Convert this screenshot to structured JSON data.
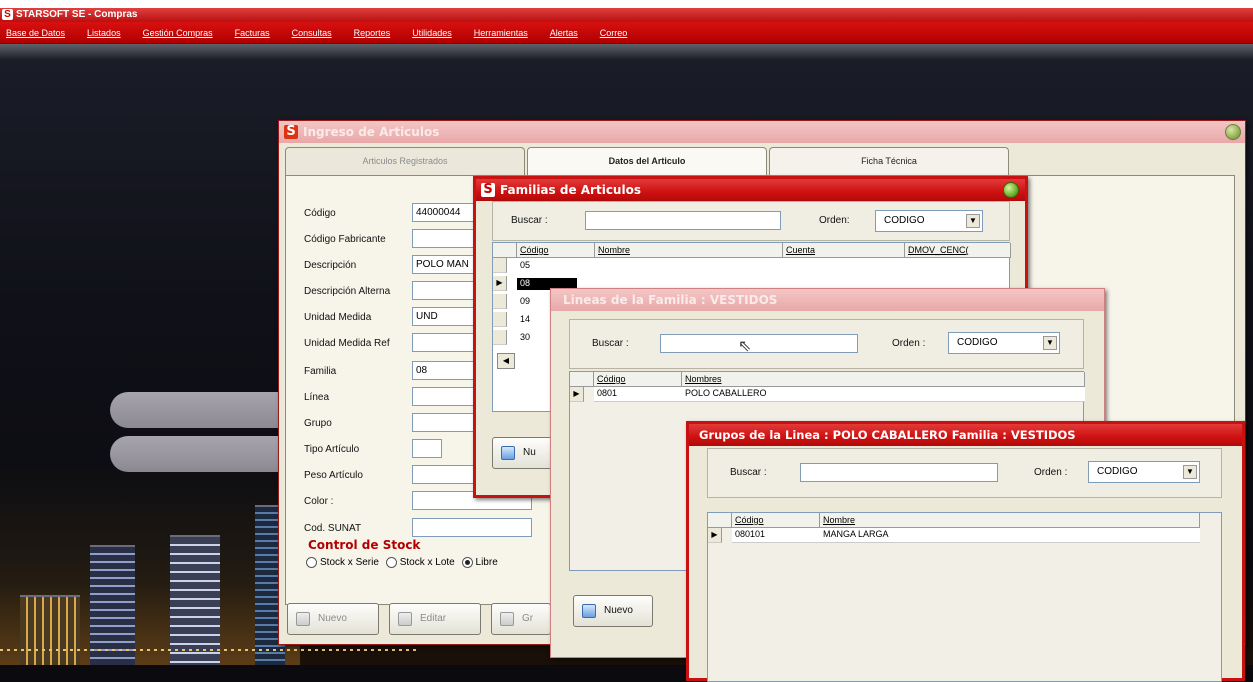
{
  "app": {
    "title": "STARSOFT SE - Compras",
    "menu": [
      "Base de Datos",
      "Listados",
      "Gestión Compras",
      "Facturas",
      "Consultas",
      "Reportes",
      "Utilidades",
      "Herramientas",
      "Alertas",
      "Correo"
    ]
  },
  "articulos": {
    "title": "Ingreso de Articulos",
    "tabs": [
      "Articulos Registrados",
      "Datos del Articulo",
      "Ficha Técnica"
    ],
    "active_tab": "Datos del Articulo",
    "fields": [
      {
        "label": "Código",
        "value": "44000044"
      },
      {
        "label": "Código Fabricante",
        "value": ""
      },
      {
        "label": "Descripción",
        "value": "POLO MAN"
      },
      {
        "label": "Descripción Alterna",
        "value": ""
      },
      {
        "label": "Unidad Medida",
        "value": "UND"
      },
      {
        "label": "Unidad Medida Ref",
        "value": ""
      },
      {
        "label": "Familia",
        "value": "08"
      },
      {
        "label": "Línea",
        "value": ""
      },
      {
        "label": "Grupo",
        "value": ""
      },
      {
        "label": "Tipo Artículo",
        "value": ""
      },
      {
        "label": "Peso Artículo",
        "value": ""
      },
      {
        "label": "Color :",
        "value": ""
      },
      {
        "label": "Cod. SUNAT",
        "value": ""
      }
    ],
    "stock_title": "Control de Stock",
    "stock_options": [
      "Stock x Serie",
      "Stock x Lote",
      "Libre"
    ],
    "stock_selected": "Libre",
    "buttons": [
      "Nuevo",
      "Editar",
      "Gr"
    ]
  },
  "familias": {
    "title": "Familias de Articulos",
    "buscar_label": "Buscar :",
    "buscar_value": "",
    "orden_label": "Orden:",
    "orden_value": "CODIGO",
    "columns": [
      "Código",
      "Nombre",
      "Cuenta",
      "DMOV_CENC("
    ],
    "rows": [
      "05",
      "08",
      "09",
      "14",
      "30"
    ],
    "selected_row": "08",
    "button": "Nu"
  },
  "lineas": {
    "title": "Lineas de la Familia : VESTIDOS",
    "buscar_label": "Buscar :",
    "buscar_value": "",
    "orden_label": "Orden :",
    "orden_value": "CODIGO",
    "columns": [
      "Código",
      "Nombres"
    ],
    "rows": [
      {
        "codigo": "0801",
        "nombre": "POLO CABALLERO"
      }
    ],
    "button": "Nuevo"
  },
  "grupos": {
    "title": "Grupos de la Linea : POLO CABALLERO Familia : VESTIDOS",
    "buscar_label": "Buscar :",
    "buscar_value": "",
    "orden_label": "Orden :",
    "orden_value": "CODIGO",
    "columns": [
      "Código",
      "Nombre"
    ],
    "rows": [
      {
        "codigo": "080101",
        "nombre": "MANGA LARGA"
      }
    ]
  },
  "colors": {
    "menubar": "#c80808",
    "accent_red": "#c81212",
    "window_bg": "#ece9d8",
    "stock_title": "#b30000"
  },
  "icons": [
    "s-logo-icon",
    "close-icon",
    "dropdown-arrow-icon",
    "row-pointer-icon",
    "new-doc-icon",
    "edit-icon",
    "mouse-cursor-icon"
  ]
}
